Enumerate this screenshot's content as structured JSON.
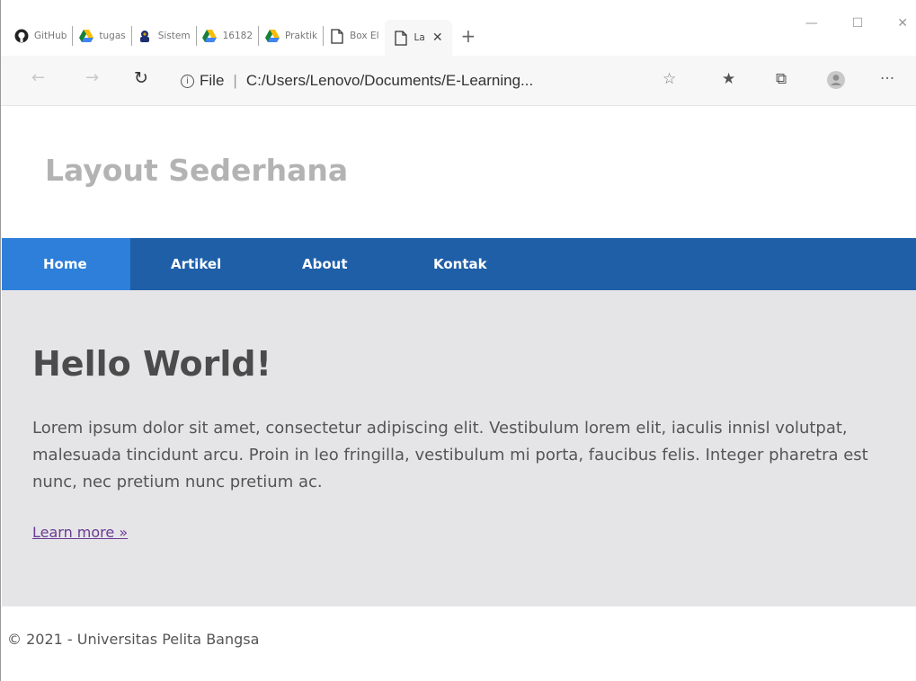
{
  "browser": {
    "tabs": [
      {
        "label": "GitHub",
        "icon": "github-icon"
      },
      {
        "label": "tugas",
        "icon": "google-drive-icon"
      },
      {
        "label": "Sistem",
        "icon": "campus-logo-icon"
      },
      {
        "label": "16182",
        "icon": "google-drive-icon"
      },
      {
        "label": "Praktik",
        "icon": "google-drive-icon"
      },
      {
        "label": "Box El",
        "icon": "page-icon"
      },
      {
        "label": "La",
        "icon": "page-icon"
      }
    ],
    "active_tab_close": "✕",
    "new_tab": "+",
    "address": {
      "info": "i",
      "scheme_label": "File",
      "url": "C:/Users/Lenovo/Documents/E-Learning..."
    },
    "window_controls": {
      "minimize": "—",
      "maximize": "☐",
      "close": "✕"
    }
  },
  "page": {
    "site_title": "Layout Sederhana",
    "nav": [
      "Home",
      "Artikel",
      "About",
      "Kontak"
    ],
    "hero": {
      "heading": "Hello World!",
      "body": "Lorem ipsum dolor sit amet, consectetur adipiscing elit. Vestibulum lorem elit, iaculis innisl volutpat, malesuada tincidunt arcu. Proin in leo fringilla, vestibulum mi porta, faucibus felis. Integer pharetra est nunc, nec pretium nunc pretium ac.",
      "link": "Learn more »"
    },
    "footer": "© 2021 - Universitas Pelita Bangsa"
  },
  "colors": {
    "nav_bg": "#1e5fa8",
    "nav_active": "#2d7fd9",
    "hero_bg": "#e5e5e8",
    "title": "#b3b3b3",
    "link": "#6a3b93"
  }
}
